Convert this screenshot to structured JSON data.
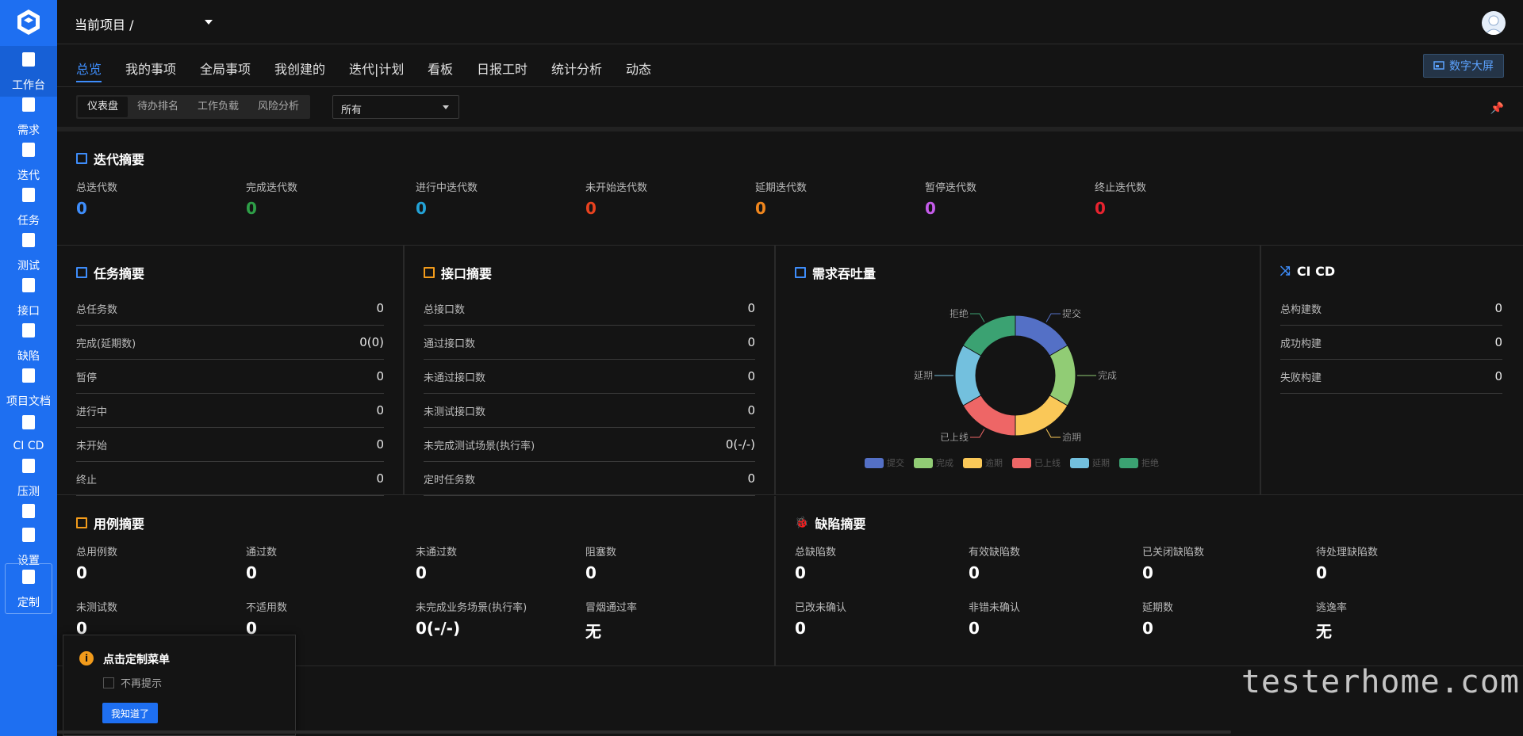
{
  "sidebar": {
    "items": [
      {
        "label": "工作台",
        "icon": "monitor-icon"
      },
      {
        "label": "需求",
        "icon": "document-icon"
      },
      {
        "label": "迭代",
        "icon": "stack-icon"
      },
      {
        "label": "任务",
        "icon": "clipboard-icon"
      },
      {
        "label": "测试",
        "icon": "flask-icon"
      },
      {
        "label": "接口",
        "icon": "api-icon"
      },
      {
        "label": "缺陷",
        "icon": "bug-icon"
      },
      {
        "label": "项目文档",
        "icon": "book-icon"
      },
      {
        "label": "CI CD",
        "icon": "cicd-icon"
      },
      {
        "label": "压测",
        "icon": "gauge-icon"
      },
      {
        "label": "",
        "icon": "file-edit-icon"
      },
      {
        "label": "设置",
        "icon": "gear-icon"
      },
      {
        "label": "定制",
        "icon": "grid-icon"
      }
    ]
  },
  "header": {
    "project_label": "当前项目 /"
  },
  "tabs": [
    "总览",
    "我的事项",
    "全局事项",
    "我创建的",
    "迭代|计划",
    "看板",
    "日报工时",
    "统计分析",
    "动态"
  ],
  "bigscreen_label": "数字大屏",
  "subtabs": [
    "仪表盘",
    "待办排名",
    "工作负载",
    "风险分析"
  ],
  "filter": {
    "selected": "所有"
  },
  "iteration": {
    "title": "迭代摘要",
    "stats": [
      {
        "label": "总迭代数",
        "value": "0",
        "color": "#3e8dfb"
      },
      {
        "label": "完成迭代数",
        "value": "0",
        "color": "#2e9e47"
      },
      {
        "label": "进行中迭代数",
        "value": "0",
        "color": "#23a2d6"
      },
      {
        "label": "未开始迭代数",
        "value": "0",
        "color": "#e8421f"
      },
      {
        "label": "延期迭代数",
        "value": "0",
        "color": "#f0861d"
      },
      {
        "label": "暂停迭代数",
        "value": "0",
        "color": "#c45bea"
      },
      {
        "label": "终止迭代数",
        "value": "0",
        "color": "#e8232f"
      }
    ]
  },
  "task": {
    "title": "任务摘要",
    "rows": [
      {
        "label": "总任务数",
        "value": "0"
      },
      {
        "label": "完成(延期数)",
        "value": "0(0)"
      },
      {
        "label": "暂停",
        "value": "0"
      },
      {
        "label": "进行中",
        "value": "0"
      },
      {
        "label": "未开始",
        "value": "0"
      },
      {
        "label": "终止",
        "value": "0"
      }
    ]
  },
  "api": {
    "title": "接口摘要",
    "rows": [
      {
        "label": "总接口数",
        "value": "0"
      },
      {
        "label": "通过接口数",
        "value": "0"
      },
      {
        "label": "未通过接口数",
        "value": "0"
      },
      {
        "label": "未测试接口数",
        "value": "0"
      },
      {
        "label": "未完成测试场景(执行率)",
        "value": "0(-/-)"
      },
      {
        "label": "定时任务数",
        "value": "0"
      }
    ]
  },
  "demand": {
    "title": "需求吞吐量"
  },
  "chart_data": {
    "type": "pie",
    "title": "需求吞吐量",
    "categories": [
      "提交",
      "完成",
      "逾期",
      "已上线",
      "延期",
      "拒绝"
    ],
    "values": [
      1,
      1,
      1,
      1,
      1,
      1
    ],
    "colors": [
      "#5470c6",
      "#91cc75",
      "#fac858",
      "#ee6666",
      "#73c0de",
      "#3ba272"
    ],
    "legend_position": "bottom"
  },
  "cicd": {
    "title": "CI CD",
    "rows": [
      {
        "label": "总构建数",
        "value": "0"
      },
      {
        "label": "成功构建",
        "value": "0"
      },
      {
        "label": "失败构建",
        "value": "0"
      }
    ]
  },
  "cases": {
    "title": "用例摘要",
    "stats": [
      {
        "label": "总用例数",
        "value": "0"
      },
      {
        "label": "通过数",
        "value": "0"
      },
      {
        "label": "未通过数",
        "value": "0"
      },
      {
        "label": "阻塞数",
        "value": "0"
      },
      {
        "label": "未测试数",
        "value": "0"
      },
      {
        "label": "不适用数",
        "value": "0"
      },
      {
        "label": "未完成业务场景(执行率)",
        "value": "0(-/-)"
      },
      {
        "label": "冒烟通过率",
        "value": "无"
      }
    ]
  },
  "defects": {
    "title": "缺陷摘要",
    "stats": [
      {
        "label": "总缺陷数",
        "value": "0"
      },
      {
        "label": "有效缺陷数",
        "value": "0"
      },
      {
        "label": "已关闭缺陷数",
        "value": "0"
      },
      {
        "label": "待处理缺陷数",
        "value": "0"
      },
      {
        "label": "已改未确认",
        "value": "0"
      },
      {
        "label": "非错未确认",
        "value": "0"
      },
      {
        "label": "延期数",
        "value": "0"
      },
      {
        "label": "逃逸率",
        "value": "无"
      }
    ]
  },
  "popover": {
    "title": "点击定制菜单",
    "checkbox_label": "不再提示",
    "button": "我知道了"
  },
  "watermark": "testerhome.com"
}
